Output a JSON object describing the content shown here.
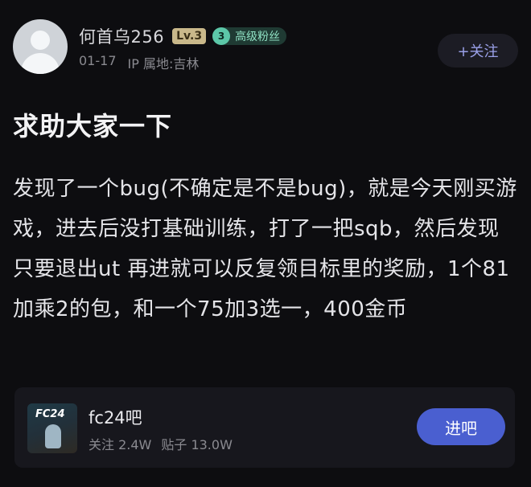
{
  "post": {
    "author": {
      "username": "何首乌256",
      "level_badge": "Lv.3",
      "fan_level": "3",
      "fan_label": "高级粉丝"
    },
    "meta": {
      "date": "01-17",
      "ip_location": "IP 属地:吉林"
    },
    "follow_label": "+关注",
    "title": "求助大家一下",
    "body": "发现了一个bug(不确定是不是bug)，就是今天刚买游戏，进去后没打基础训练，打了一把sqb，然后发现只要退出ut 再进就可以反复领目标里的奖励，1个81加乘2的包，和一个75加3选一，400金币"
  },
  "forum": {
    "thumb_text": "FC24",
    "name": "fc24吧",
    "followers": "关注 2.4W",
    "posts": "贴子 13.0W",
    "enter_label": "进吧"
  }
}
